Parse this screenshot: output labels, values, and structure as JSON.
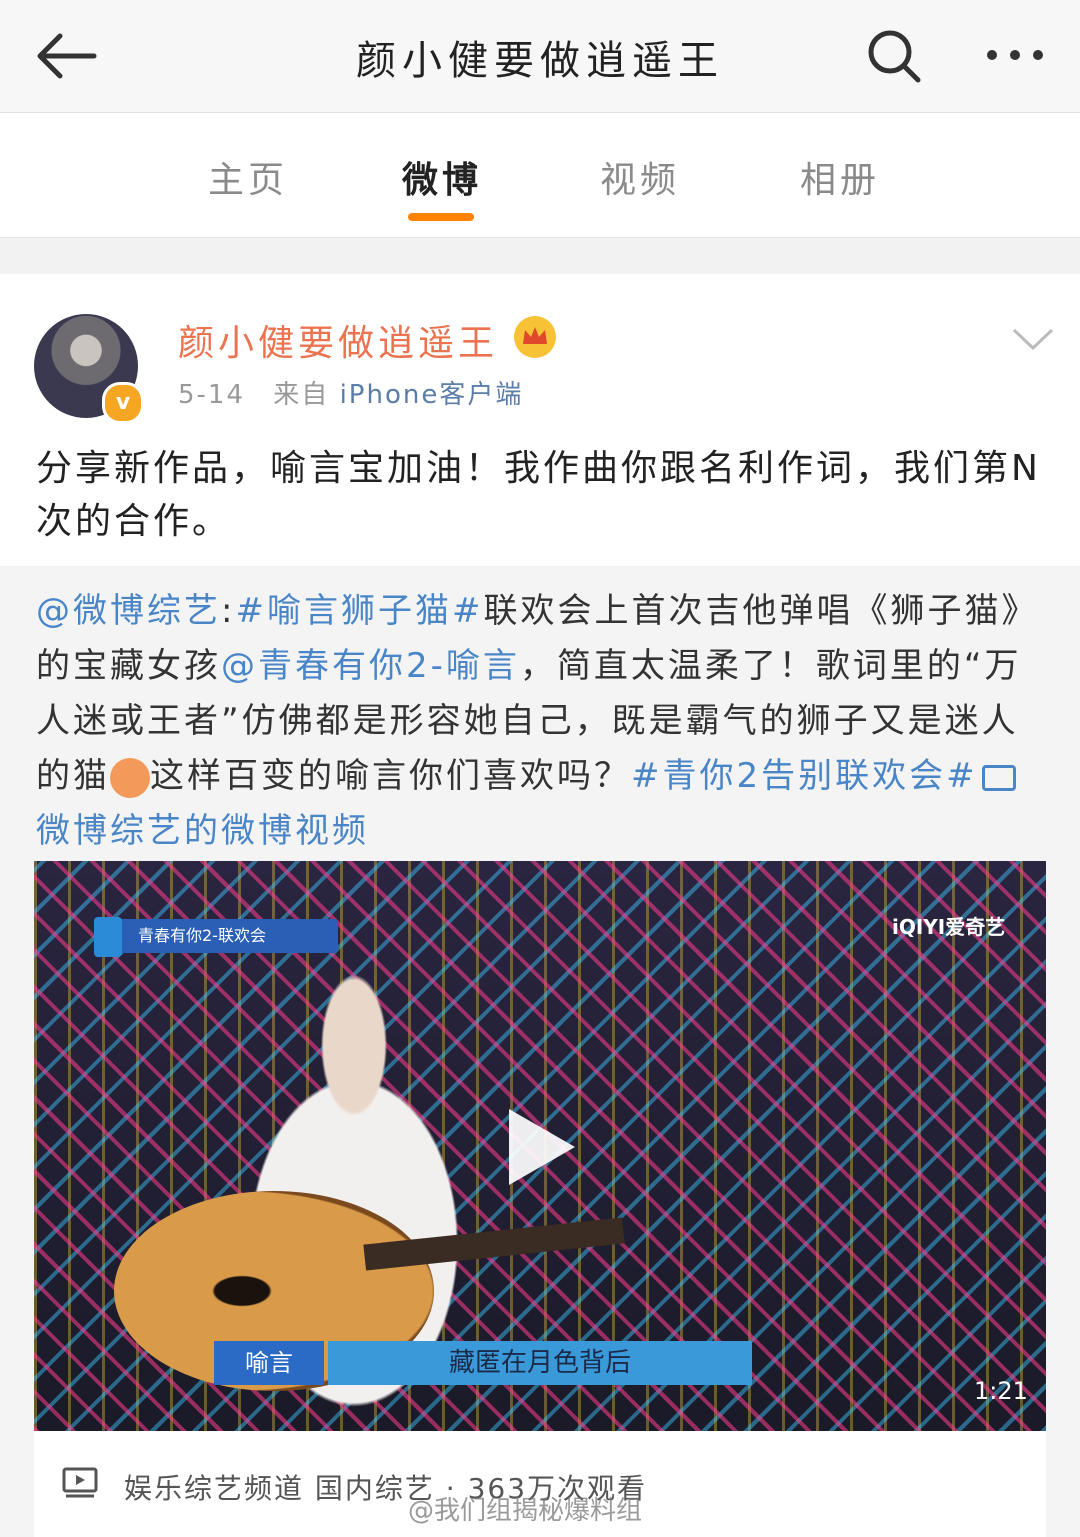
{
  "header": {
    "title": "颜小健要做逍遥王"
  },
  "tabs": [
    {
      "label": "主页"
    },
    {
      "label": "微博"
    },
    {
      "label": "视频"
    },
    {
      "label": "相册"
    }
  ],
  "post": {
    "username": "颜小健要做逍遥王",
    "date": "5-14",
    "source_prefix": "来自",
    "source": "iPhone客户端",
    "text": "分享新作品，喻言宝加油！我作曲你跟名利作词，我们第N次的合作。"
  },
  "repost": {
    "mention1": "@微博综艺",
    "sep": ":",
    "hashtag1": "#喻言狮子猫#",
    "text1": "联欢会上首次吉他弹唱《狮子猫》的宝藏女孩",
    "mention2": "@青春有你2-喻言",
    "text2": "，简直太温柔了！歌词里的“万人迷或王者”仿佛都是形容她自己，既是霸气的狮子又是迷人的猫",
    "text3": "这样百变的喻言你们喜欢吗？",
    "hashtag2": "#青你2告别联欢会#",
    "video_link": "微博综艺的微博视频"
  },
  "video": {
    "show_tag": "青春有你2-联欢会",
    "platform": "iQIYI爱奇艺",
    "nameplate": "喻言",
    "subtitle": "藏匿在月色背后",
    "duration": "1:21"
  },
  "video_footer": {
    "text": "娱乐综艺频道 国内综艺 · 363万次观看"
  },
  "watermark": "@我们组揭秘爆料组",
  "colors": {
    "accent": "#ff8200",
    "username": "#eb7350",
    "link": "#4a86c7"
  }
}
